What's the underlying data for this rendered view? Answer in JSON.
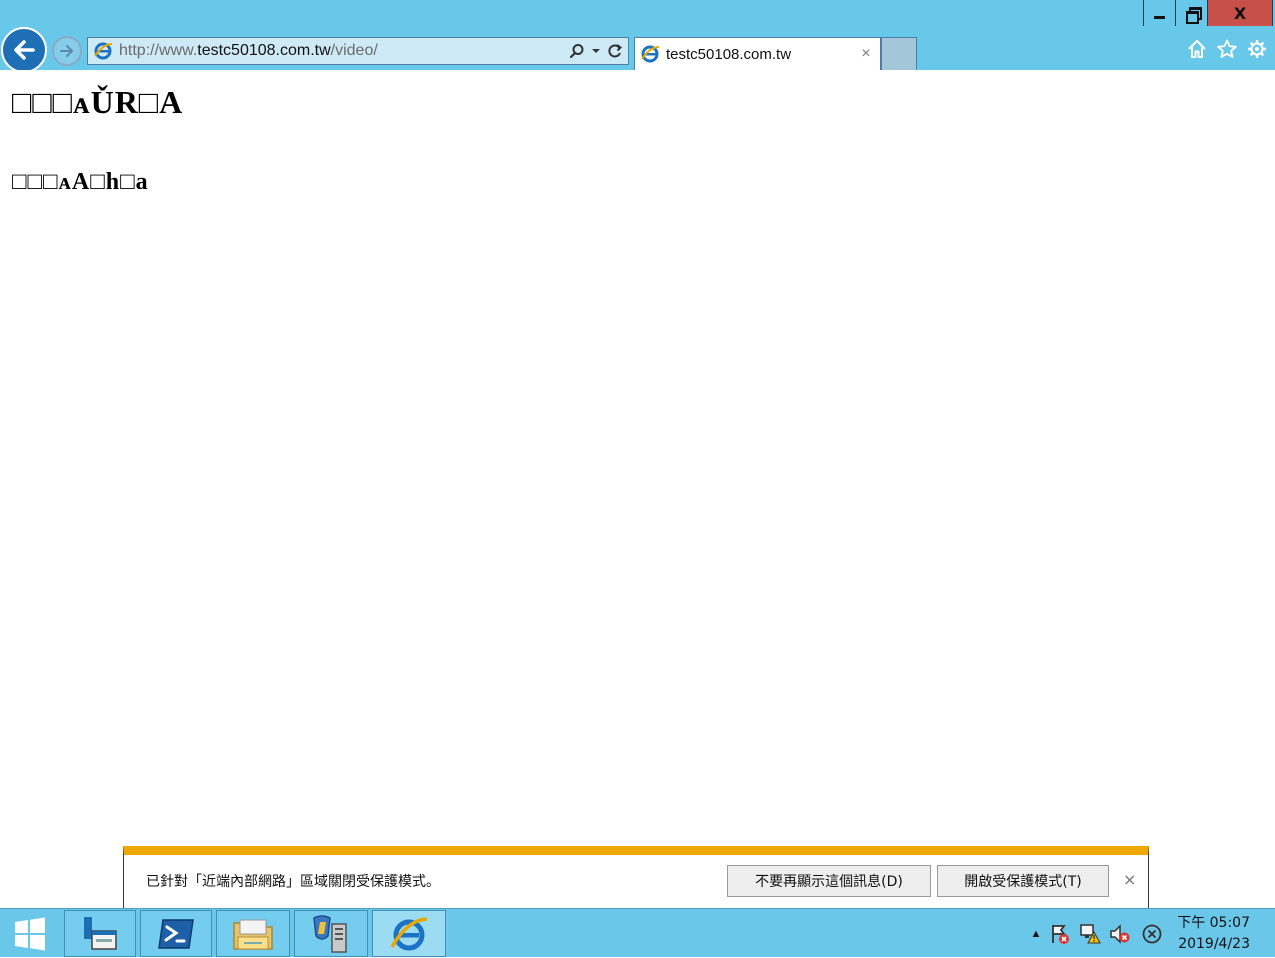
{
  "window": {
    "minimize_icon": "minimize-icon",
    "restore_icon": "restore-icon",
    "close_label": "X"
  },
  "nav": {
    "back_icon": "arrow-left-icon",
    "forward_icon": "arrow-right-icon"
  },
  "address_bar": {
    "url_prefix": "http://www.",
    "url_host": "testc50108.com.tw",
    "url_path": "/video/",
    "search_icon": "search-icon",
    "dropdown_icon": "caret-down-icon",
    "refresh_icon": "refresh-icon"
  },
  "tab": {
    "title": "testc50108.com.tw",
    "close_label": "×"
  },
  "toolbar": {
    "home_icon": "home-icon",
    "favorites_icon": "star-icon",
    "settings_icon": "gear-icon"
  },
  "page": {
    "heading": "□□□ᴀǓR□A",
    "subheading": "□□□ᴀA□h□a"
  },
  "notification": {
    "message": "已針對「近端內部網路」區域關閉受保護模式。",
    "dismiss_label": "不要再顯示這個訊息(D)",
    "enable_label": "開啟受保護模式(T)",
    "close_label": "×",
    "accent_color": "#eea800"
  },
  "taskbar": {
    "start_icon": "windows-start-icon",
    "apps": [
      "server-manager-icon",
      "powershell-icon",
      "file-explorer-icon",
      "network-tools-icon",
      "internet-explorer-icon"
    ],
    "tray_expand": "▲",
    "tray_icons": [
      "action-center-icon",
      "network-warning-icon",
      "volume-muted-icon",
      "error-circle-icon"
    ],
    "clock_time": "下午 05:07",
    "clock_date": "2019/4/23"
  },
  "colors": {
    "chrome_bg": "#67c8ea",
    "close_button": "#c7504a",
    "back_button": "#1e6fb6",
    "taskbar_bg": "#6ac7e9"
  }
}
